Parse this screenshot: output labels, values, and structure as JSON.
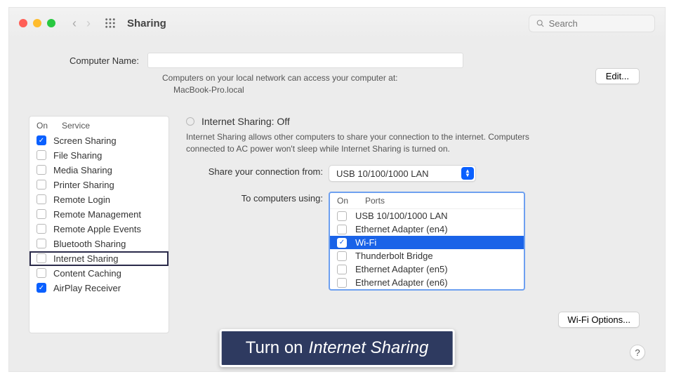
{
  "toolbar": {
    "title": "Sharing",
    "search_placeholder": "Search"
  },
  "computer_name": {
    "label": "Computer Name:",
    "hint_line1": "Computers on your local network can access your computer at:",
    "hint_host": "MacBook-Pro.local",
    "edit_label": "Edit..."
  },
  "services": {
    "head_on": "On",
    "head_service": "Service",
    "items": [
      {
        "on": true,
        "label": "Screen Sharing"
      },
      {
        "on": false,
        "label": "File Sharing"
      },
      {
        "on": false,
        "label": "Media Sharing"
      },
      {
        "on": false,
        "label": "Printer Sharing"
      },
      {
        "on": false,
        "label": "Remote Login"
      },
      {
        "on": false,
        "label": "Remote Management"
      },
      {
        "on": false,
        "label": "Remote Apple Events"
      },
      {
        "on": false,
        "label": "Bluetooth Sharing"
      },
      {
        "on": false,
        "label": "Internet Sharing",
        "highlighted": true
      },
      {
        "on": false,
        "label": "Content Caching"
      },
      {
        "on": true,
        "label": "AirPlay Receiver"
      }
    ]
  },
  "detail": {
    "status": "Internet Sharing: Off",
    "description": "Internet Sharing allows other computers to share your connection to the internet. Computers connected to AC power won't sleep while Internet Sharing is turned on.",
    "share_from_label": "Share your connection from:",
    "share_from_value": "USB 10/100/1000 LAN",
    "to_label": "To computers using:",
    "ports_head_on": "On",
    "ports_head_ports": "Ports",
    "ports": [
      {
        "on": false,
        "label": "USB 10/100/1000 LAN"
      },
      {
        "on": false,
        "label": "Ethernet Adapter (en4)"
      },
      {
        "on": true,
        "label": "Wi-Fi",
        "selected": true
      },
      {
        "on": false,
        "label": "Thunderbolt Bridge"
      },
      {
        "on": false,
        "label": "Ethernet Adapter (en5)"
      },
      {
        "on": false,
        "label": "Ethernet Adapter (en6)"
      }
    ],
    "wifi_options_label": "Wi-Fi Options..."
  },
  "help_label": "?",
  "caption": {
    "prefix": "Turn on",
    "emphasis": "Internet Sharing"
  }
}
